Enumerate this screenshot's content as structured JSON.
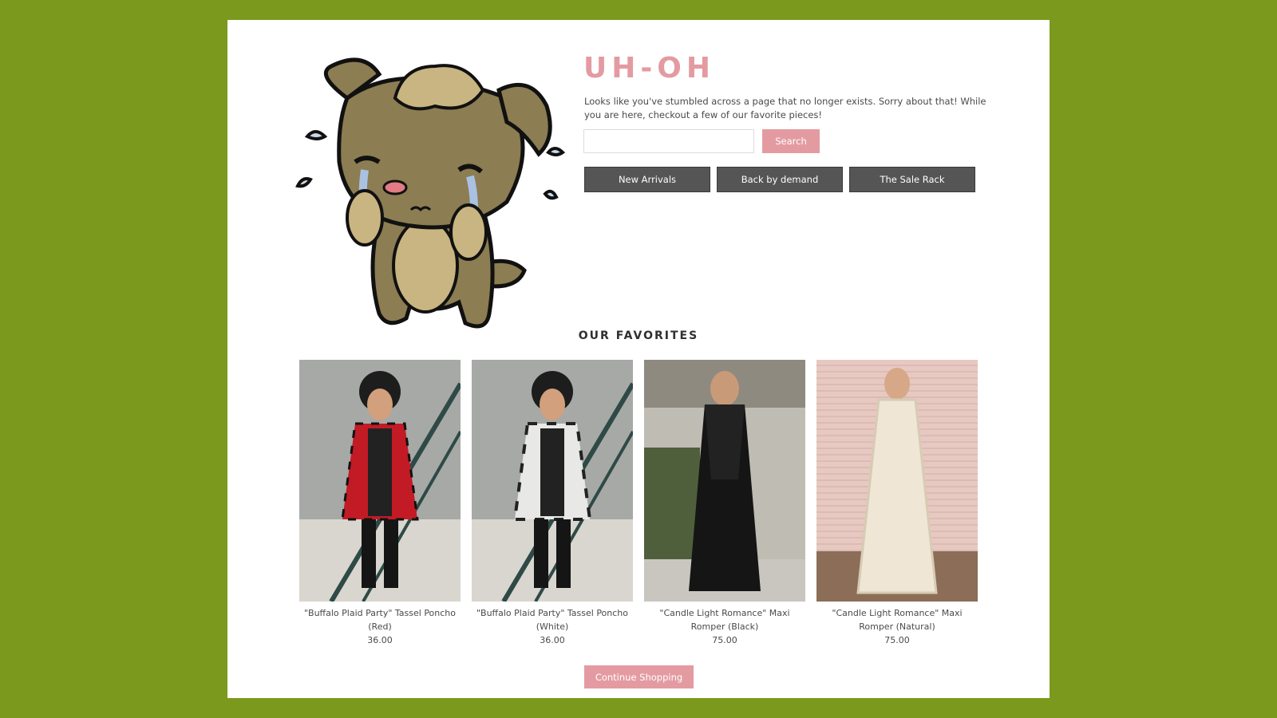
{
  "colors": {
    "page_background": "#7b9a1d",
    "accent_pink": "#e39ba1",
    "nav_button": "#555555"
  },
  "error": {
    "title": "UH-OH",
    "message": "Looks like you've stumbled across a page that no longer exists. Sorry about that! While you are here, checkout a few of our favorite pieces!",
    "mascot_icon": "crying-dog-icon"
  },
  "search": {
    "placeholder": "",
    "value": "",
    "button_label": "Search"
  },
  "nav_buttons": [
    {
      "label": "New Arrivals"
    },
    {
      "label": "Back by demand"
    },
    {
      "label": "The Sale Rack"
    }
  ],
  "favorites": {
    "heading": "OUR FAVORITES",
    "products": [
      {
        "name": "\"Buffalo Plaid Party\" Tassel Poncho (Red)",
        "price": "36.00"
      },
      {
        "name": "\"Buffalo Plaid Party\" Tassel Poncho (White)",
        "price": "36.00"
      },
      {
        "name": "\"Candle Light Romance\" Maxi Romper (Black)",
        "price": "75.00"
      },
      {
        "name": "\"Candle Light Romance\" Maxi Romper (Natural)",
        "price": "75.00"
      }
    ]
  },
  "continue_label": "Continue Shopping"
}
